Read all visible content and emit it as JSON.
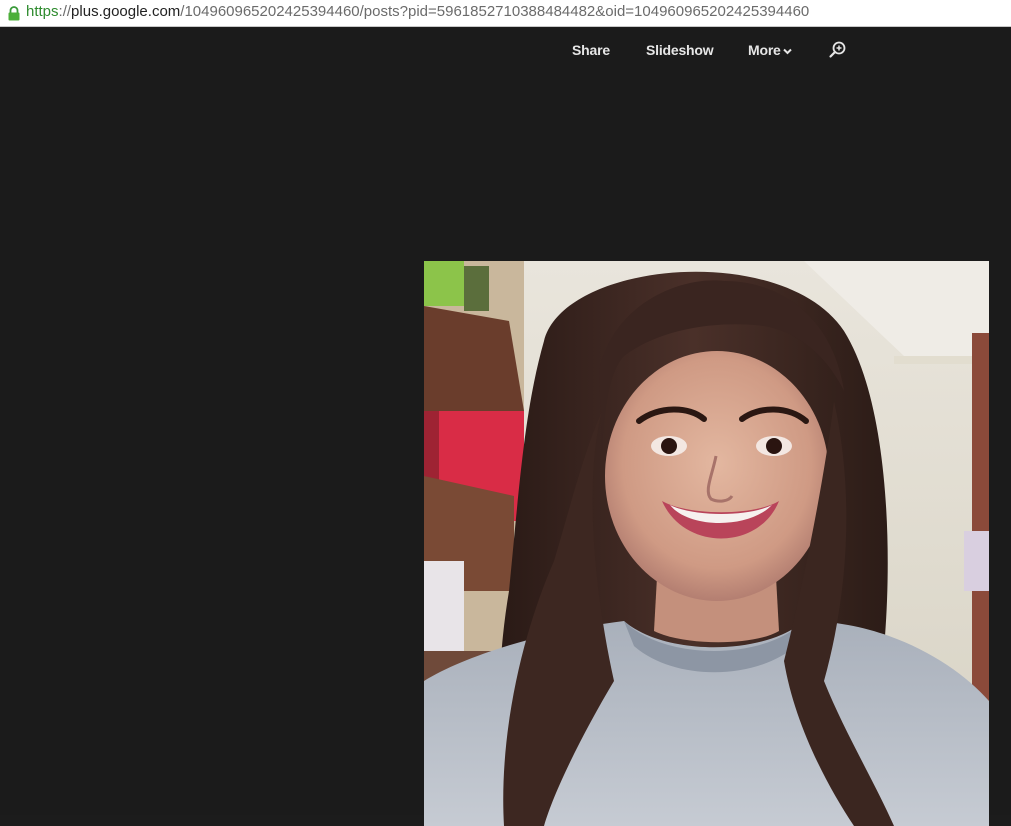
{
  "browser": {
    "url_scheme": "https",
    "url_separator": "://",
    "url_host": "plus.google.com",
    "url_path": "/104960965202425394460/posts?pid=5961852710388484482&oid=104960965202425394460"
  },
  "toolbar": {
    "share_label": "Share",
    "slideshow_label": "Slideshow",
    "more_label": "More"
  },
  "photo": {
    "description_icon": "portrait-photo"
  },
  "colors": {
    "viewer_background": "#1b1b1b",
    "secure_green": "#2e8b2e"
  }
}
